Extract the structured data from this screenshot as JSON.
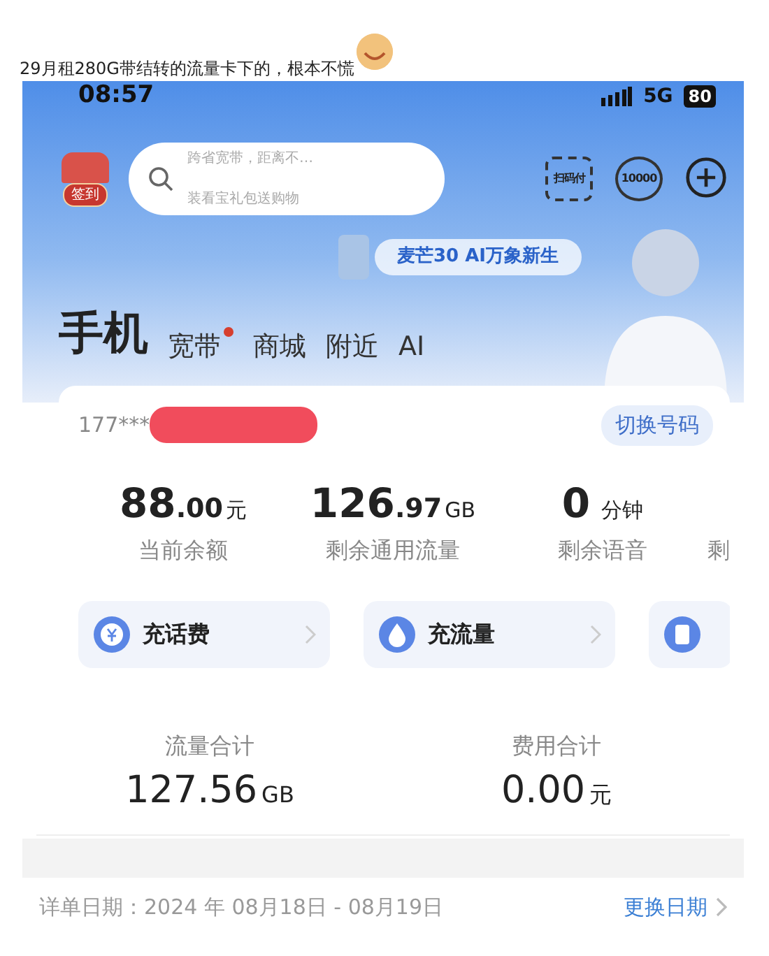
{
  "post": {
    "caption": "29月租280G带结转的流量卡下的，根本不慌"
  },
  "status_bar": {
    "time": "08:57",
    "network": "5G",
    "battery": "80"
  },
  "header": {
    "checkin_label": "签到",
    "search": {
      "hints": [
        "跨省宽带，距离不…",
        "装看宝礼包送购物"
      ]
    },
    "toolbar": [
      {
        "kind": "scan",
        "label": "扫码付"
      },
      {
        "kind": "service",
        "label": "10000"
      },
      {
        "kind": "add"
      }
    ],
    "promo": "麦芒30 AI万象新生"
  },
  "tabs": [
    {
      "label": "手机",
      "selected": true,
      "dot": false
    },
    {
      "label": "宽带",
      "selected": false,
      "dot": true
    },
    {
      "label": "商城",
      "selected": false,
      "dot": false
    },
    {
      "label": "附近",
      "selected": false,
      "dot": false
    },
    {
      "label": "AI",
      "selected": false,
      "dot": false
    }
  ],
  "account": {
    "number": "177***",
    "switch_button": "切换号码",
    "stats": [
      {
        "int": "88",
        "dec": ".00",
        "unit": "元",
        "label": "当前余额"
      },
      {
        "int": "126",
        "dec": ".97",
        "unit": "GB",
        "label": "剩余通用流量"
      },
      {
        "int": "0",
        "unit": "分钟",
        "label": "剩余语音"
      },
      {
        "label": "剩"
      }
    ],
    "actions": [
      {
        "kind": "yuan",
        "label": "充话费"
      },
      {
        "kind": "drop",
        "label": "充流量"
      },
      {
        "kind": "doc"
      }
    ]
  },
  "summary": [
    {
      "label": "流量合计",
      "value": "127.56",
      "unit": "GB"
    },
    {
      "label": "费用合计",
      "value": "0.00",
      "unit": "元"
    }
  ],
  "detail": {
    "date_label": "详单日期：2024 年 08月18日 - 08月19日",
    "change_link": "更换日期"
  }
}
